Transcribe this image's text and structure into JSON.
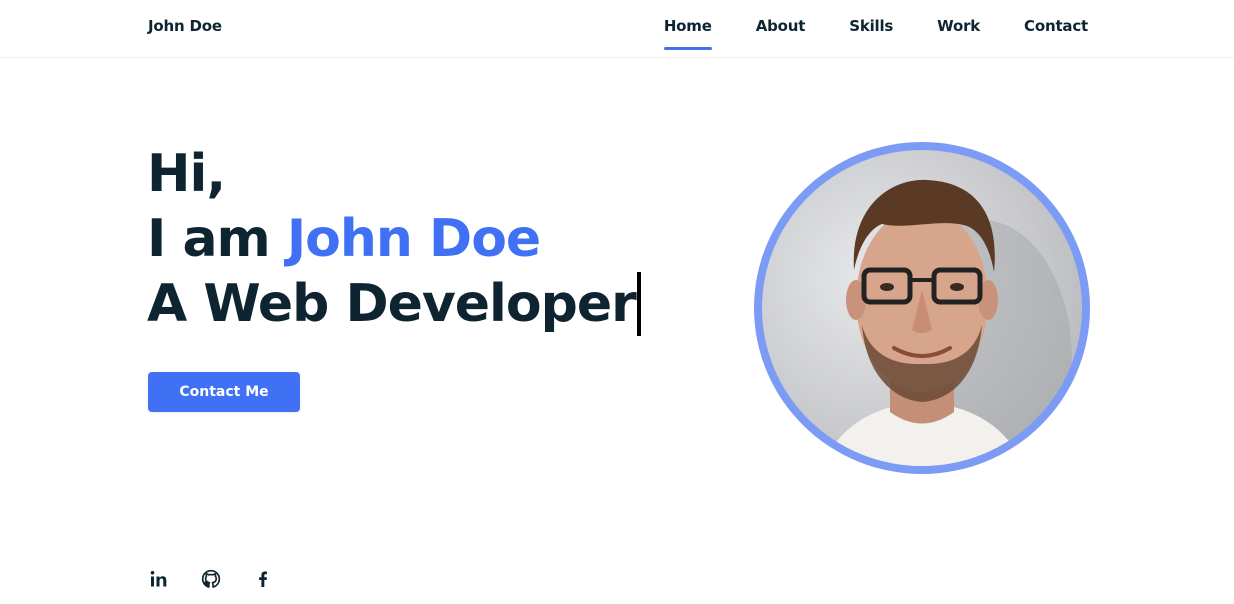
{
  "header": {
    "logo": "John Doe",
    "nav": [
      {
        "label": "Home",
        "active": true
      },
      {
        "label": "About",
        "active": false
      },
      {
        "label": "Skills",
        "active": false
      },
      {
        "label": "Work",
        "active": false
      },
      {
        "label": "Contact",
        "active": false
      }
    ]
  },
  "hero": {
    "greeting": "Hi,",
    "intro_prefix": "I am ",
    "name": "John Doe",
    "role": "A Web Developer",
    "cta_label": "Contact Me"
  },
  "socials": [
    {
      "icon": "linkedin-icon",
      "glyph": "in"
    },
    {
      "icon": "github-icon"
    },
    {
      "icon": "facebook-icon",
      "glyph": "f"
    }
  ],
  "colors": {
    "accent": "#4070f4",
    "text": "#0e2431",
    "avatar_ring": "#7b9bf5"
  }
}
